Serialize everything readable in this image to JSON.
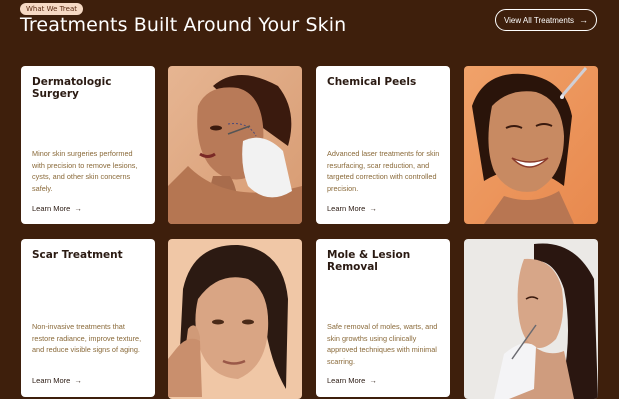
{
  "header": {
    "badge": "What We Treat",
    "title": "Treatments Built Around Your Skin",
    "view_all_label": "View All Treatments"
  },
  "cards": [
    {
      "title": "Dermatologic Surgery",
      "description": "Minor skin surgeries performed with precision to remove lesions, cysts, and other skin concerns safely.",
      "link": "Learn More"
    },
    {
      "title": "Chemical Peels",
      "description": "Advanced laser treatments for skin resurfacing, scar reduction, and targeted correction with controlled precision.",
      "link": "Learn More"
    },
    {
      "title": "Scar Treatment",
      "description": "Non-invasive treatments that restore radiance, improve texture, and reduce visible signs of aging.",
      "link": "Learn More"
    },
    {
      "title": "Mole & Lesion Removal",
      "description": "Safe removal of moles, warts, and skin growths using clinically approved techniques with minimal scarring.",
      "link": "Learn More"
    }
  ],
  "icons": {
    "arrow": "arrow-right-icon"
  },
  "colors": {
    "background": "#3e1f0c",
    "badge": "#f6d9c4",
    "accent_text": "#8a6a3a"
  }
}
